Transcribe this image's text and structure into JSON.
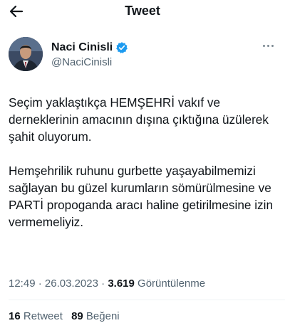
{
  "header": {
    "title": "Tweet",
    "back_icon": "arrow-left-icon"
  },
  "author": {
    "display_name": "Naci Cinisli",
    "handle": "@NaciCinisli",
    "verified": true,
    "verified_color": "#1d9bf0",
    "avatar_icon": "avatar-photo",
    "more_icon": "more-horizontal-icon"
  },
  "tweet": {
    "paragraphs": [
      "Seçim yaklaştıkça HEMŞEHRİ vakıf ve derneklerinin amacının dışına çıktığına üzülerek şahit oluyorum.",
      "Hemşehrilik ruhunu gurbette yaşayabilmemizi sağlayan bu güzel kurumların sömürülmesine ve PARTİ propoganda aracı haline getirilmesine izin vermemeliyiz."
    ]
  },
  "meta": {
    "time": "12:49",
    "separator": "·",
    "date": "26.03.2023",
    "views_count": "3.619",
    "views_label": "Görüntülenme"
  },
  "stats": {
    "retweets_count": "16",
    "retweets_label": "Retweet",
    "likes_count": "89",
    "likes_label": "Beğeni"
  }
}
